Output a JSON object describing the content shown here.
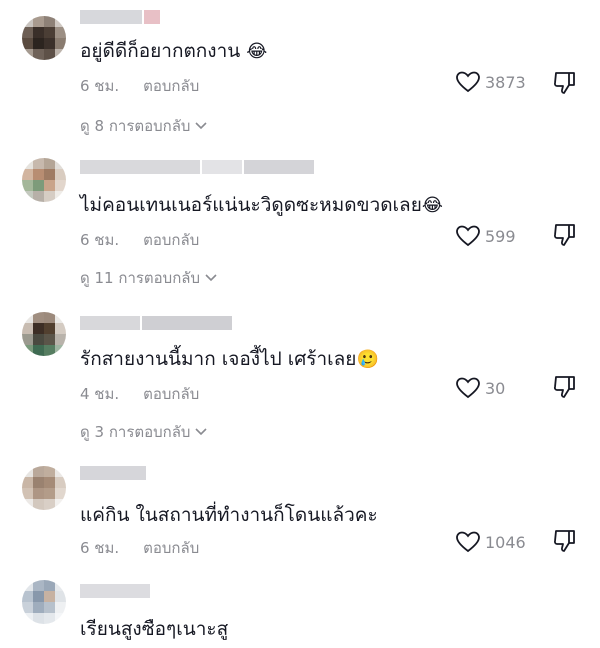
{
  "comments": [
    {
      "text": "อยู่ดีดีก็อยากตกงาน",
      "emoji": "😂",
      "time": "6 ชม.",
      "reply_label": "ตอบกลับ",
      "likes": "3873",
      "view_replies": "ดู 8 การตอบกลับ"
    },
    {
      "text": "ไม่คอนเทนเนอร์แน่นะวิดูดซะหมดขวดเลย",
      "emoji": "😂",
      "time": "6 ชม.",
      "reply_label": "ตอบกลับ",
      "likes": "599",
      "view_replies": "ดู 11 การตอบกลับ"
    },
    {
      "text": "รักสายงานนี้มาก เจองี้ไป เศร้าเลย",
      "emoji": "🥲",
      "time": "4 ชม.",
      "reply_label": "ตอบกลับ",
      "likes": "30",
      "view_replies": "ดู 3 การตอบกลับ"
    },
    {
      "text": "แค่กิน ในสถานที่ทำงานก็โดนแล้วคะ",
      "emoji": "",
      "time": "6 ชม.",
      "reply_label": "ตอบกลับ",
      "likes": "1046",
      "view_replies": ""
    },
    {
      "text": "เรียนสูงซือๆเนาะสู",
      "emoji": "",
      "time": "",
      "reply_label": "",
      "likes": "",
      "view_replies": ""
    }
  ],
  "icons": {
    "like": "heart-outline-icon",
    "dislike": "thumbs-down-outline-icon",
    "expand": "chevron-down-icon"
  },
  "colors": {
    "text": "#161823",
    "muted": "#8a8b91",
    "username_blur": "#d6d6da"
  }
}
